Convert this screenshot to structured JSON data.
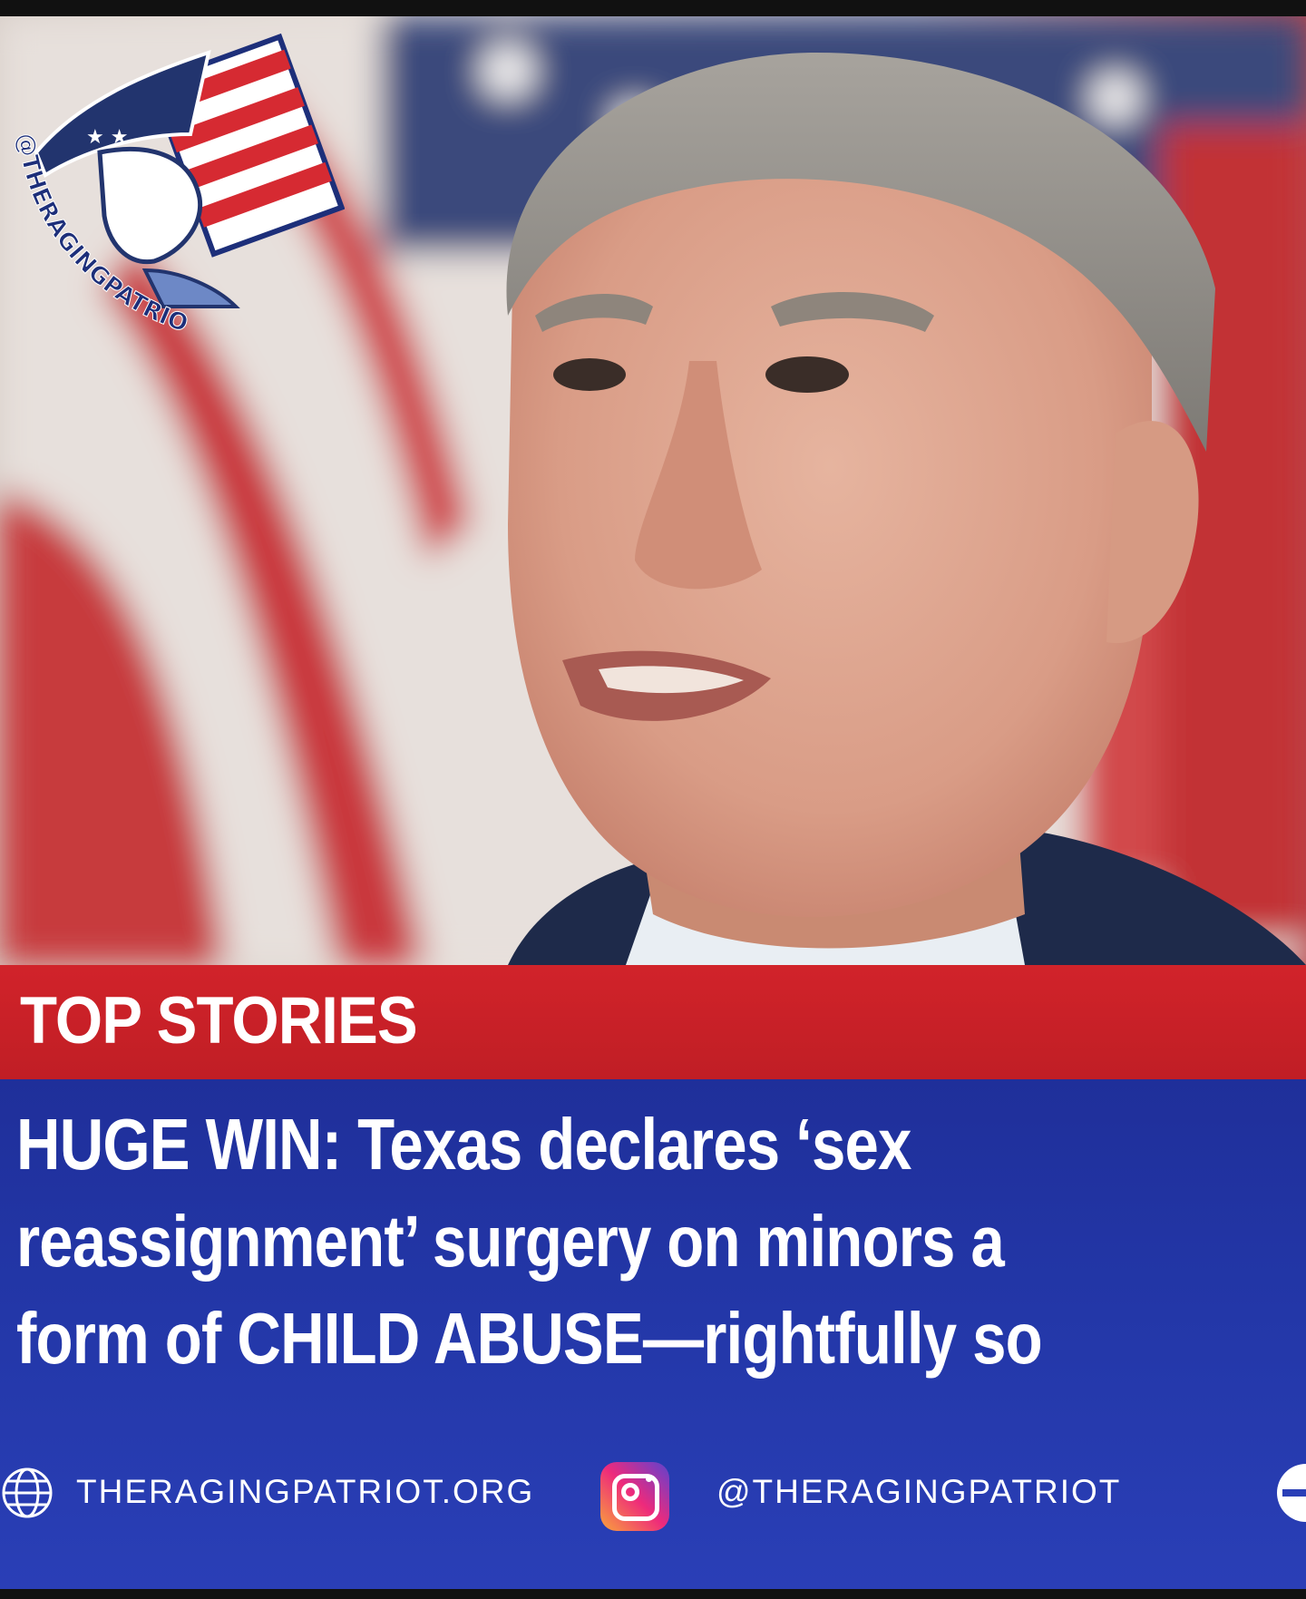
{
  "logo": {
    "handle_text": "@THERAGINGPATRIOT"
  },
  "banner": {
    "label": "TOP STORIES"
  },
  "headline": {
    "lines": [
      "HUGE WIN: Texas declares ‘sex",
      "reassignment’ surgery on minors a",
      "form of CHILD ABUSE—rightfully so"
    ]
  },
  "footer": {
    "website": "THERAGINGPATRIOT.ORG",
    "instagram_handle": "@THERAGINGPATRIOT",
    "icons": [
      "globe-icon",
      "instagram-icon"
    ]
  },
  "colors": {
    "banner_red": "#c8222a",
    "panel_blue": "#2337a8",
    "text": "#ffffff"
  }
}
